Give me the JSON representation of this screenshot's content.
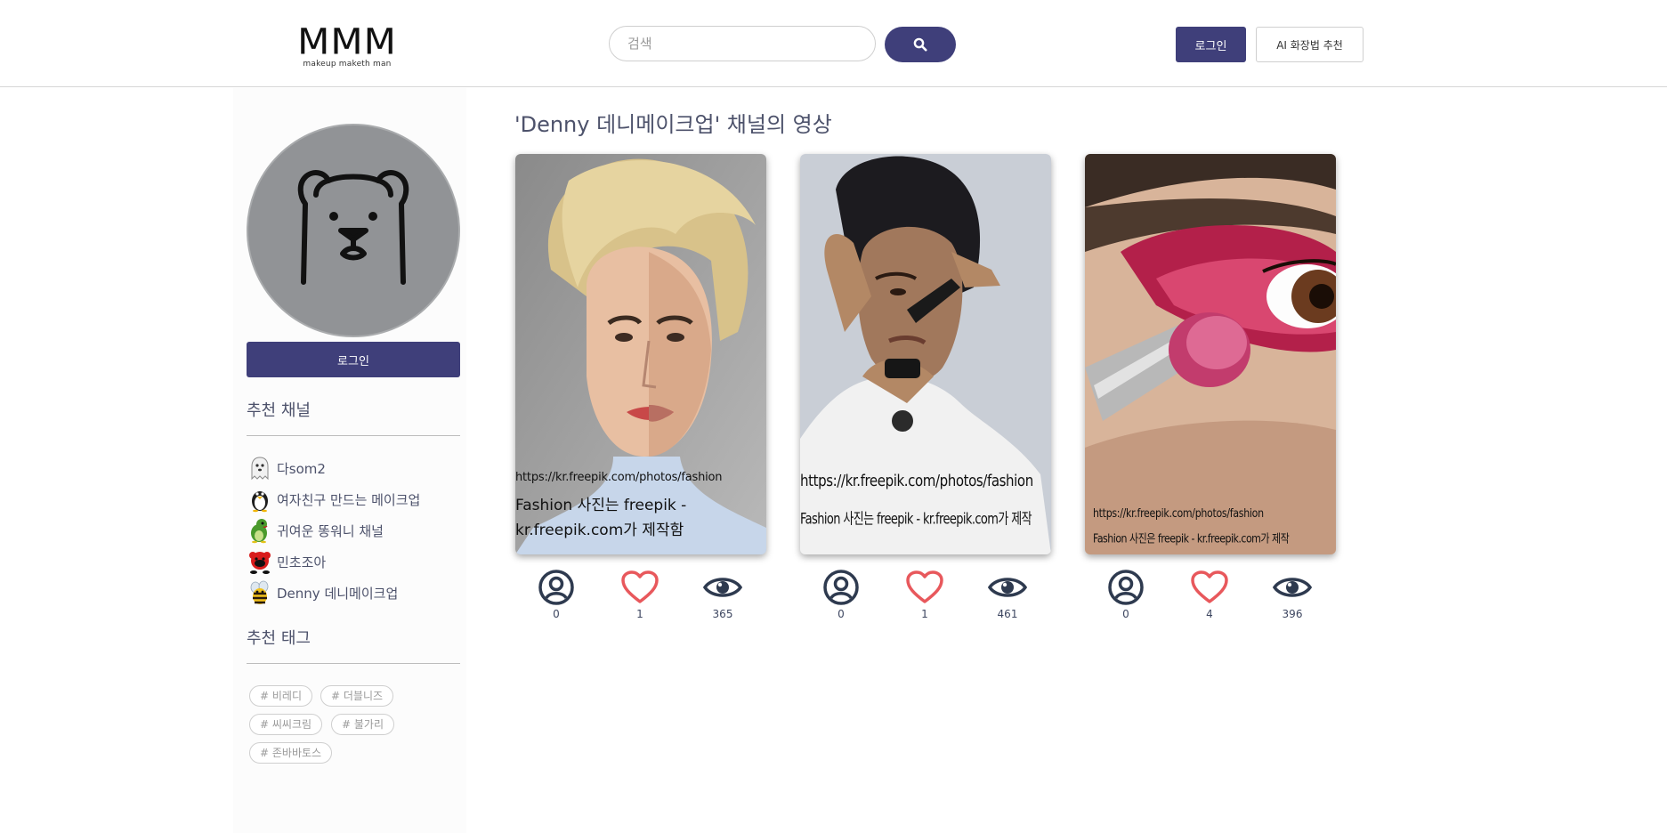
{
  "header": {
    "logo_main": "MMM",
    "logo_sub": "makeup maketh man",
    "search_placeholder": "검색",
    "search_icon": "search-icon",
    "login_label": "로그인",
    "ai_label": "AI 화장법 추천"
  },
  "sidebar": {
    "login_label": "로그인",
    "channels_heading": "추천 채널",
    "channels": [
      {
        "name": "다som2",
        "icon": "ghost-icon"
      },
      {
        "name": "여자친구 만드는 메이크업",
        "icon": "penguin-icon"
      },
      {
        "name": "귀여운 똥워니 채널",
        "icon": "dinosaur-icon"
      },
      {
        "name": "민초조아",
        "icon": "red-creature-icon"
      },
      {
        "name": "Denny 데니메이크업",
        "icon": "bee-icon"
      }
    ],
    "tags_heading": "추천 태그",
    "tags": [
      "# 비레디",
      "# 더블니즈",
      "# 씨씨크림",
      "# 불가리",
      "# 존바바토스"
    ]
  },
  "main": {
    "title": "'Denny 데니메이크업' 채널의 영상",
    "videos": [
      {
        "watermark_url": "https://kr.freepik.com/photos/fashion",
        "watermark_line2": "Fashion 사진는 freepik -",
        "watermark_line3": "kr.freepik.com가 제작함",
        "subscribers": "0",
        "likes": "1",
        "views": "365"
      },
      {
        "watermark_url": "https://kr.freepik.com/photos/fashion",
        "watermark_line2": "Fashion 사진는 freepik - kr.freepik.com가 제작",
        "watermark_line3": "",
        "subscribers": "0",
        "likes": "1",
        "views": "461"
      },
      {
        "watermark_url": "https://kr.freepik.com/photos/fashion",
        "watermark_line2": "Fashion 사진은 freepik - kr.freepik.com가 제작",
        "watermark_line3": "",
        "subscribers": "0",
        "likes": "4",
        "views": "396"
      }
    ]
  },
  "colors": {
    "accent": "#3f3f7a",
    "heart": "#e8585c",
    "icon_dark": "#2e3a4f"
  }
}
